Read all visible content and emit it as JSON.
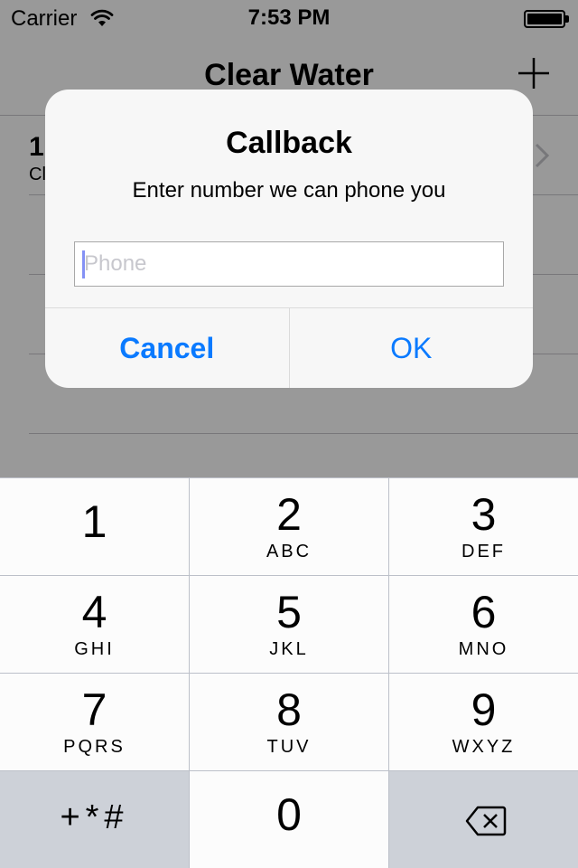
{
  "status": {
    "carrier": "Carrier",
    "time": "7:53 PM"
  },
  "nav": {
    "title": "Clear Water"
  },
  "list": {
    "rows": [
      {
        "title": "1",
        "subtitle": "Cl"
      }
    ]
  },
  "alert": {
    "title": "Callback",
    "message": "Enter number we can phone you",
    "phone_placeholder": "Phone",
    "phone_value": "",
    "cancel_label": "Cancel",
    "ok_label": "OK"
  },
  "keypad": {
    "keys": [
      {
        "digit": "1",
        "letters": ""
      },
      {
        "digit": "2",
        "letters": "ABC"
      },
      {
        "digit": "3",
        "letters": "DEF"
      },
      {
        "digit": "4",
        "letters": "GHI"
      },
      {
        "digit": "5",
        "letters": "JKL"
      },
      {
        "digit": "6",
        "letters": "MNO"
      },
      {
        "digit": "7",
        "letters": "PQRS"
      },
      {
        "digit": "8",
        "letters": "TUV"
      },
      {
        "digit": "9",
        "letters": "WXYZ"
      }
    ],
    "symbols_label": "+*#",
    "zero": "0"
  },
  "colors": {
    "accent": "#0a7aff",
    "keypad_bg": "#bcc0c9",
    "alert_bg": "#f7f7f7"
  }
}
